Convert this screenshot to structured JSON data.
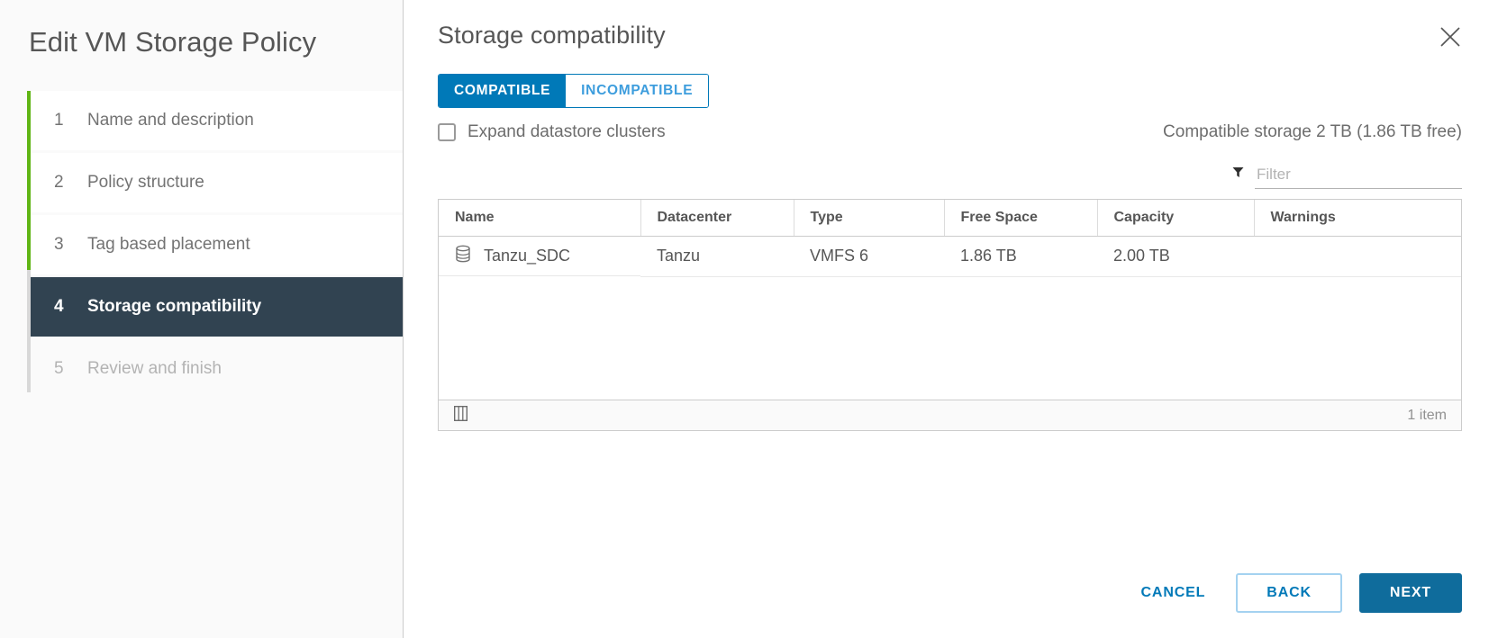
{
  "wizard": {
    "title": "Edit VM Storage Policy",
    "steps": [
      {
        "num": "1",
        "label": "Name and description",
        "state": "done"
      },
      {
        "num": "2",
        "label": "Policy structure",
        "state": "done"
      },
      {
        "num": "3",
        "label": "Tag based placement",
        "state": "done"
      },
      {
        "num": "4",
        "label": "Storage compatibility",
        "state": "active"
      },
      {
        "num": "5",
        "label": "Review and finish",
        "state": "upcoming"
      }
    ]
  },
  "pane": {
    "title": "Storage compatibility",
    "close_icon": "close-icon"
  },
  "toggle": {
    "compatible_label": "COMPATIBLE",
    "incompatible_label": "INCOMPATIBLE",
    "selected": "COMPATIBLE"
  },
  "expand": {
    "label": "Expand datastore clusters",
    "checked": false
  },
  "summary": {
    "storage_info": "Compatible storage 2 TB (1.86 TB free)"
  },
  "filter": {
    "icon": "funnel-icon",
    "placeholder": "Filter",
    "value": ""
  },
  "table": {
    "columns": [
      "Name",
      "Datacenter",
      "Type",
      "Free Space",
      "Capacity",
      "Warnings"
    ],
    "rows": [
      {
        "icon": "datastore-icon",
        "name": "Tanzu_SDC",
        "datacenter": "Tanzu",
        "type": "VMFS 6",
        "free_space": "1.86 TB",
        "capacity": "2.00 TB",
        "warnings": ""
      }
    ],
    "footer": {
      "column_picker_icon": "column-picker-icon",
      "item_count": "1 item"
    }
  },
  "actions": {
    "cancel_label": "CANCEL",
    "back_label": "BACK",
    "next_label": "NEXT"
  },
  "colors": {
    "accent_blue": "#0079b8",
    "primary_button": "#0f6c9c",
    "active_step": "#314351",
    "completed_rail": "#60b515"
  }
}
